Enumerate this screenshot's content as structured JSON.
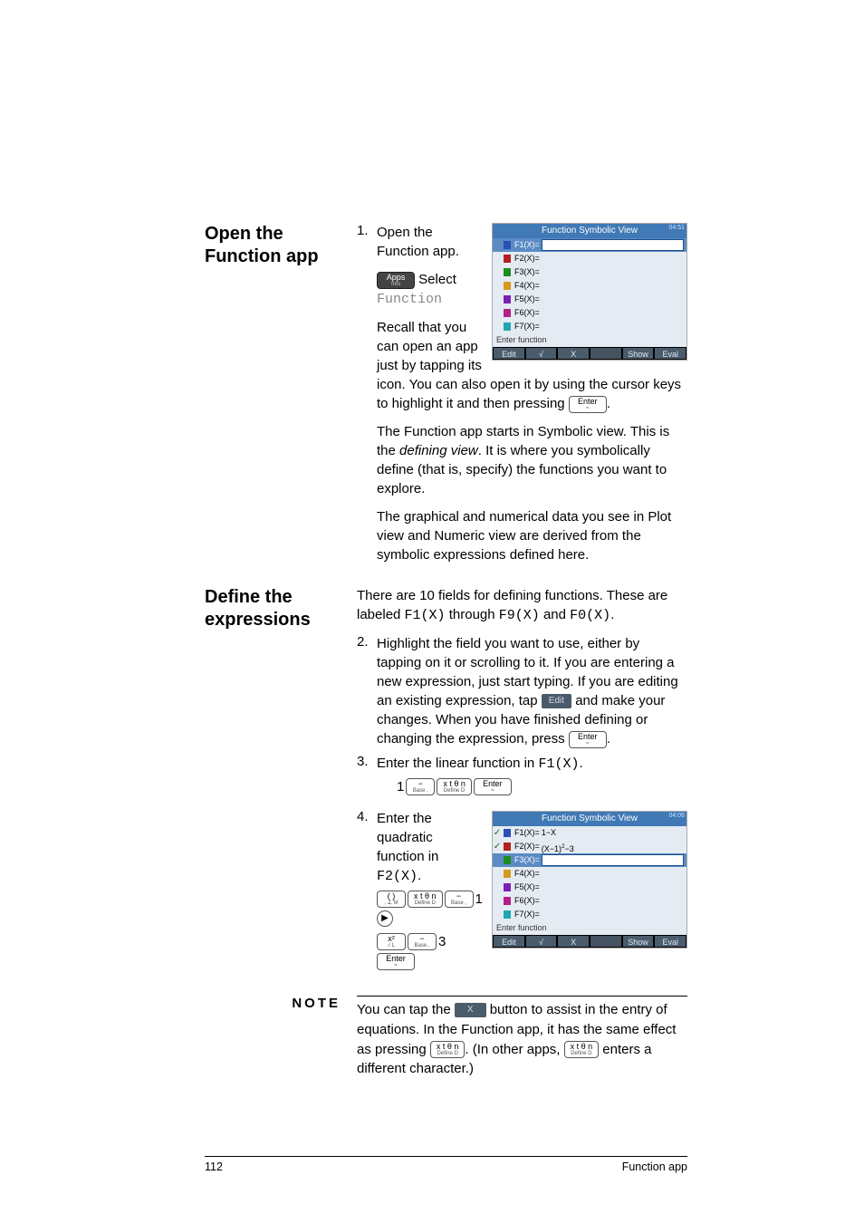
{
  "sections": {
    "open": {
      "heading": "Open the Function app",
      "step1_num": "1.",
      "step1_text": "Open the Function app.",
      "step1_sub_select_prefix": " Select ",
      "step1_sub_function": "Function",
      "step1_recall": "Recall that you can open an app just by tapping its icon. You can also open it by using the cursor keys to highlight it and then pressing ",
      "step1_dot": ".",
      "p2a": "The Function app starts in Symbolic view. This is the ",
      "p2b": "defining view",
      "p2c": ". It is where you symbolically define (that is, specify) the functions you want to explore.",
      "p3": "The graphical and numerical data you see in Plot view and Numeric view are derived from the symbolic expressions defined here."
    },
    "define": {
      "heading": "Define the expressions",
      "intro_a": "There are 10 fields for defining functions. These are labeled ",
      "intro_f1": "F1(X)",
      "intro_mid": " through ",
      "intro_f9": "F9(X)",
      "intro_and": " and ",
      "intro_f0": "F0(X)",
      "intro_dot": ".",
      "step2_num": "2.",
      "step2_a": "Highlight the field you want to use, either by tapping on it or scrolling to it. If you are entering a new expression, just start typing. If you are editing an existing expression, tap ",
      "step2_edit": "Edit",
      "step2_b": " and make your changes. When you have finished defining or changing the expression, press ",
      "step2_dot": ".",
      "step3_num": "3.",
      "step3_a": "Enter the linear function in ",
      "step3_fn": "F1(X)",
      "step3_dot": ".",
      "step4_num": "4.",
      "step4_a": "Enter the quadratic function in ",
      "step4_fn": "F2(X)",
      "step4_dot": "."
    },
    "note": {
      "label": "NOTE",
      "text_a": "You can tap the ",
      "btn_x": "X",
      "text_b": " button to assist in the entry of equations. In the Function app, it has the same effect as pressing ",
      "text_c": ". (In other apps, ",
      "text_d": " enters a different character.)"
    }
  },
  "keys": {
    "apps": "Apps",
    "apps_sub": "Info",
    "enter": "Enter",
    "enter_sub": "≈",
    "minus": "−",
    "minus_sub": "Base   ,",
    "xttn": "x t θ n",
    "xttn_sub": "Define   D",
    "paren": "( )",
    "paren_sub": ",   ∠   M",
    "xsq": "x²",
    "xsq_sub": "√   L"
  },
  "seq": {
    "one": "1",
    "three": "3"
  },
  "screenshot": {
    "title": "Function Symbolic View",
    "corner1": "04:51",
    "corner2": "04:06",
    "rows": [
      {
        "label": "F1(X)=",
        "color": "sw-c1"
      },
      {
        "label": "F2(X)=",
        "color": "sw-c2"
      },
      {
        "label": "F3(X)=",
        "color": "sw-c3"
      },
      {
        "label": "F4(X)=",
        "color": "sw-c4"
      },
      {
        "label": "F5(X)=",
        "color": "sw-c5"
      },
      {
        "label": "F6(X)=",
        "color": "sw-c6"
      },
      {
        "label": "F7(X)=",
        "color": "sw-c7"
      }
    ],
    "hint": "Enter function",
    "soft": [
      "Edit",
      "√",
      "X",
      "",
      "Show",
      "Eval"
    ],
    "f1val": "1−X",
    "f2val_a": "(X−1)",
    "f2val_b": "−3"
  },
  "footer": {
    "page": "112",
    "title": "Function app"
  }
}
